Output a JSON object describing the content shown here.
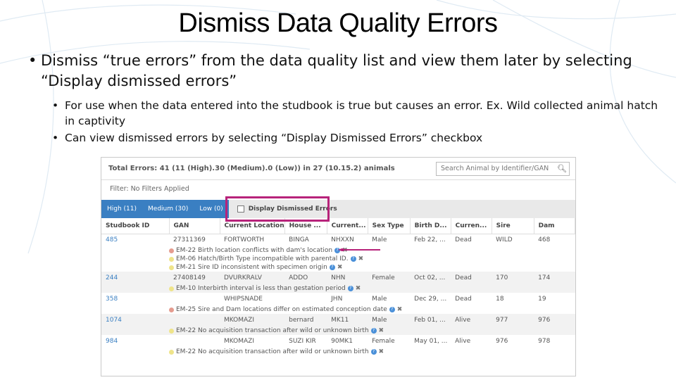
{
  "slide": {
    "title": "Dismiss Data Quality Errors",
    "bullet_main": "Dismiss “true errors” from the data quality list and view them later by selecting “Display dismissed errors”",
    "sub_bullets": [
      "For use when the data entered into the studbook is true but causes an error. Ex. Wild collected animal hatch in captivity",
      "Can view dismissed errors by selecting “Display Dismissed Errors” checkbox"
    ]
  },
  "panel": {
    "totals": "Total Errors: 41 (11 (High).30 (Medium).0 (Low)) in 27 (10.15.2) animals",
    "search_placeholder": "Search Animal by Identifier/GAN",
    "filter": "Filter: No Filters Applied",
    "tabs": [
      "High (11)",
      "Medium (30)",
      "Low (0)"
    ],
    "dismissed_label": "Display Dismissed Errors",
    "columns": [
      "Studbook ID",
      "GAN",
      "Current Location",
      "House ...",
      "Current...",
      "Sex Type",
      "Birth D...",
      "Curren...",
      "Sire",
      "Dam"
    ],
    "rows": [
      {
        "cells": [
          "485",
          "27311369",
          "FORTWORTH",
          "BINGA",
          "NHXXN",
          "Male",
          "Feb 22, ...",
          "Dead",
          "WILD",
          "468"
        ],
        "errors": [
          {
            "level": "high",
            "text": "EM-22 Birth location conflicts with dam's location"
          },
          {
            "level": "low",
            "text": "EM-06 Hatch/Birth Type incompatible with parental ID."
          },
          {
            "level": "low",
            "text": "EM-21 Sire ID inconsistent with specimen origin"
          }
        ]
      },
      {
        "cells": [
          "244",
          "27408149",
          "DVURKRALV",
          "ADDO",
          "NHN",
          "Female",
          "Oct 02, ...",
          "Dead",
          "170",
          "174"
        ],
        "errors": [
          {
            "level": "low",
            "text": "EM-10 Interbirth interval is less than gestation period"
          }
        ]
      },
      {
        "cells": [
          "358",
          "",
          "WHIPSNADE",
          "",
          "JHN",
          "Male",
          "Dec 29, ...",
          "Dead",
          "18",
          "19"
        ],
        "errors": [
          {
            "level": "high",
            "text": "EM-25 Sire and Dam locations differ on estimated conception date"
          }
        ]
      },
      {
        "cells": [
          "1074",
          "",
          "MKOMAZI",
          "bernard",
          "MK11",
          "Male",
          "Feb 01, ...",
          "Alive",
          "977",
          "976"
        ],
        "errors": [
          {
            "level": "low",
            "text": "EM-22 No acquisition transaction after wild or unknown birth"
          }
        ]
      },
      {
        "cells": [
          "984",
          "",
          "MKOMAZI",
          "SUZI KIR",
          "90MK1",
          "Female",
          "May 01, ...",
          "Alive",
          "976",
          "978"
        ],
        "errors": [
          {
            "level": "low",
            "text": "EM-22 No acquisition transaction after wild or unknown birth"
          }
        ]
      }
    ]
  },
  "colors": {
    "tab_blue": "#3a7fc2",
    "highlight_box": "#b7237a",
    "arrow": "#b7237a"
  }
}
